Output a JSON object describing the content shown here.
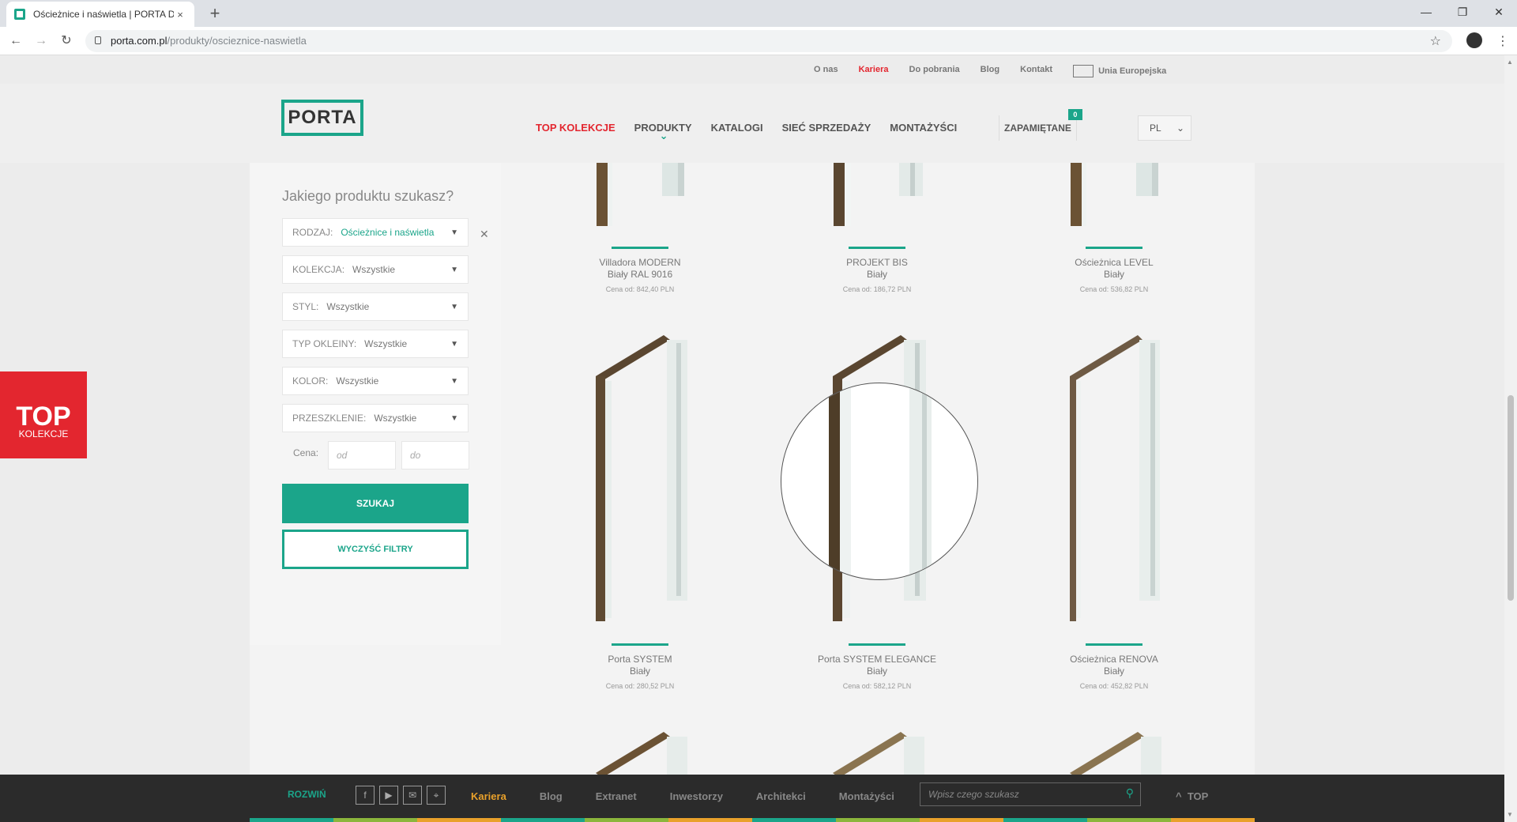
{
  "browser": {
    "tab_title": "Ościeżnice i naświetla | PORTA Drzwi",
    "tab_close": "×",
    "new_tab": "+",
    "url_domain": "porta.com.pl",
    "url_path": "/produkty/oscieznice-naswietla",
    "icons": [
      "back-icon",
      "forward-icon",
      "reload-icon",
      "lock-icon",
      "star-icon",
      "profile-icon",
      "menu-icon"
    ]
  },
  "topbar": {
    "links": [
      "O nas",
      "Kariera",
      "Do pobrania",
      "Blog",
      "Kontakt"
    ],
    "eu_label": "Unia Europejska"
  },
  "header": {
    "logo": "PORTA",
    "nav": [
      "TOP KOLEKCJE",
      "PRODUKTY",
      "KATALOGI",
      "SIEĆ SPRZEDAŻY",
      "MONTAŻYŚCI"
    ],
    "saved_label": "ZAPAMIĘTANE",
    "saved_count": "0",
    "lang": "PL"
  },
  "sidebar": {
    "title": "Jakiego produktu szukasz?",
    "filters": [
      {
        "label": "RODZAJ:",
        "value": "Ościeżnice i naświetla"
      },
      {
        "label": "KOLEKCJA:",
        "value": "Wszystkie"
      },
      {
        "label": "STYL:",
        "value": "Wszystkie"
      },
      {
        "label": "TYP OKLEINY:",
        "value": "Wszystkie"
      },
      {
        "label": "KOLOR:",
        "value": "Wszystkie"
      },
      {
        "label": "PRZESZKLENIE:",
        "value": "Wszystkie"
      }
    ],
    "price_label": "Cena:",
    "price_from_placeholder": "od",
    "price_to_placeholder": "do",
    "search_button": "SZUKAJ",
    "clear_button": "WYCZYŚĆ FILTRY"
  },
  "top_badge": {
    "big": "TOP",
    "small": "KOLEKCJE"
  },
  "products": [
    {
      "name": "Villadora MODERN",
      "variant": "Biały RAL 9016",
      "price": "Cena od: 842,40 PLN"
    },
    {
      "name": "PROJEKT BIS",
      "variant": "Biały",
      "price": "Cena od: 186,72 PLN"
    },
    {
      "name": "Ościeżnica LEVEL",
      "variant": "Biały",
      "price": "Cena od: 536,82 PLN"
    },
    {
      "name": "Porta SYSTEM",
      "variant": "Biały",
      "price": "Cena od: 280,52 PLN"
    },
    {
      "name": "Porta SYSTEM ELEGANCE",
      "variant": "Biały",
      "price": "Cena od: 582,12 PLN"
    },
    {
      "name": "Ościeżnica RENOVA",
      "variant": "Biały",
      "price": "Cena od: 452,82 PLN"
    }
  ],
  "footer": {
    "expand_label": "ROZWIŃ",
    "social": [
      "facebook-icon",
      "youtube-icon",
      "email-icon",
      "location-icon"
    ],
    "links": [
      "Kariera",
      "Blog",
      "Extranet",
      "Inwestorzy",
      "Architekci",
      "Montażyści"
    ],
    "search_placeholder": "Wpisz czego szukasz",
    "top_label": "TOP",
    "accent_colors": [
      "#1ba58a",
      "#8bb63c",
      "#e9a12b",
      "#1ba58a",
      "#8bb63c",
      "#e9a12b",
      "#1ba58a",
      "#8bb63c",
      "#e9a12b",
      "#1ba58a",
      "#8bb63c",
      "#e9a12b"
    ]
  },
  "colors": {
    "brand": "#1ba58a",
    "accent_red": "#e3262f",
    "footer_bg": "#2b2b2b"
  }
}
